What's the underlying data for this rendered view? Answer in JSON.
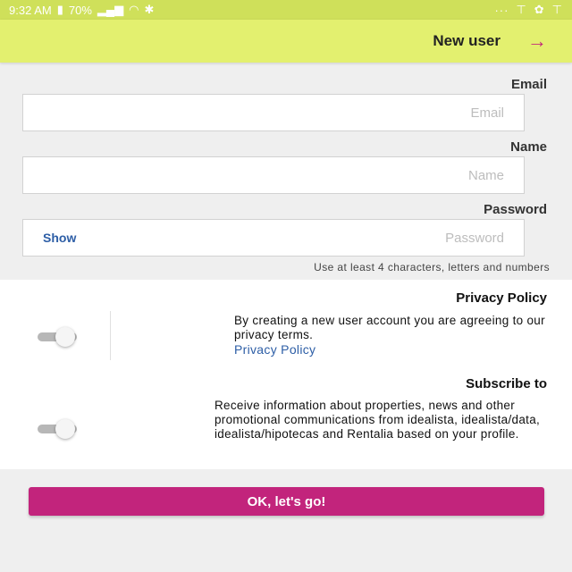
{
  "status_bar": {
    "time": "9:32 AM",
    "battery": "70%",
    "icons": [
      "battery-icon",
      "signal-icon",
      "wifi-icon",
      "bluetooth-icon",
      "vibrate-icon",
      "notification-icon",
      "overflow-dots-icon"
    ]
  },
  "app_bar": {
    "title": "New user",
    "back_icon": "arrow-icon"
  },
  "form": {
    "email": {
      "label": "Email",
      "placeholder": "Email",
      "value": ""
    },
    "name": {
      "label": "Name",
      "placeholder": "Name",
      "value": ""
    },
    "password": {
      "label": "Password",
      "placeholder": "Password",
      "value": "",
      "show_label": "Show",
      "hint": "Use at least 4 characters, letters and numbers"
    }
  },
  "privacy": {
    "title": "Privacy Policy",
    "text": "By creating a new user account you are agreeing to our privacy terms.",
    "link": "Privacy Policy",
    "toggle_on": false
  },
  "subscribe": {
    "title": "Subscribe to",
    "text": "Receive information about properties, news and other promotional communications from idealista, idealista/data, idealista/hipotecas and Rentalia based on your profile.",
    "toggle_on": false
  },
  "submit": {
    "label": "OK, let's go!"
  },
  "colors": {
    "accent": "#c2247c",
    "app_bar": "#e3f06f",
    "link": "#2d5ea6"
  }
}
